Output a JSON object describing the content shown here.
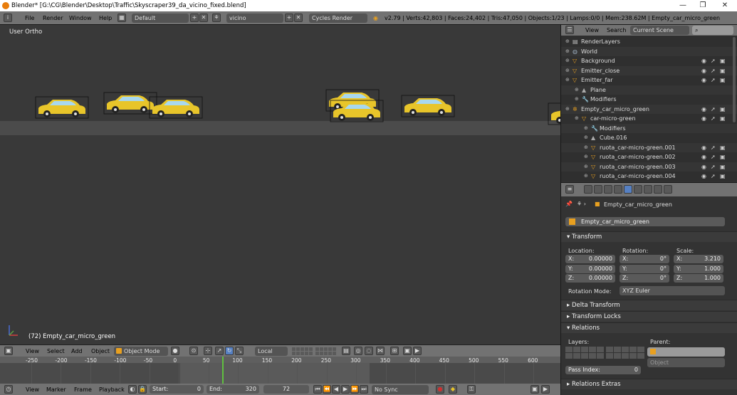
{
  "window": {
    "title": "Blender* [G:\\CG\\Blender\\Desktop\\Traffic\\Skyscraper39_da_vicino_fixed.blend]",
    "controls": [
      "—",
      "❐",
      "✕"
    ]
  },
  "infobar": {
    "menus": [
      "File",
      "Render",
      "Window",
      "Help"
    ],
    "screen_layout": "Default",
    "scene": "vicino",
    "render_engine": "Cycles Render",
    "stats": "v2.79 | Verts:42,803 | Faces:24,402 | Tris:47,050 | Objects:1/23 | Lamps:0/0 | Mem:238.62M | Empty_car_micro_green"
  },
  "viewport": {
    "view_label": "User Ortho",
    "object_label": "(72) Empty_car_micro_green",
    "header": {
      "menus": [
        "View",
        "Select",
        "Add",
        "Object"
      ],
      "mode": "Object Mode",
      "orientation": "Local"
    }
  },
  "timeline": {
    "ticks": [
      "-250",
      "-200",
      "-150",
      "-100",
      "-50",
      "0",
      "50",
      "100",
      "150",
      "200",
      "250",
      "300",
      "350",
      "400",
      "450",
      "500",
      "550",
      "600"
    ],
    "menus": [
      "View",
      "Marker",
      "Frame",
      "Playback"
    ],
    "start_label": "Start:",
    "start_value": "0",
    "end_label": "End:",
    "end_value": "320",
    "current_frame": "72",
    "sync": "No Sync"
  },
  "outliner": {
    "header": {
      "view": "View",
      "search": "Search",
      "display": "Current Scene"
    },
    "rows": [
      {
        "label": "RenderLayers",
        "indent": 0,
        "icon": "renderlayers-icon",
        "color": "#bbbbbb"
      },
      {
        "label": "World",
        "indent": 0,
        "icon": "world-icon",
        "color": "#9ab"
      },
      {
        "label": "Background",
        "indent": 0,
        "icon": "mesh-icon",
        "color": "#e8a020"
      },
      {
        "label": "Emitter_close",
        "indent": 0,
        "icon": "mesh-icon",
        "color": "#e8a020"
      },
      {
        "label": "Emitter_far",
        "indent": 0,
        "icon": "mesh-icon",
        "color": "#e8a020"
      },
      {
        "label": "Plane",
        "indent": 1,
        "icon": "mesh-data-icon",
        "color": "#aaa"
      },
      {
        "label": "Modifiers",
        "indent": 1,
        "icon": "wrench-icon",
        "color": "#aaa"
      },
      {
        "label": "Empty_car_micro_green",
        "indent": 0,
        "icon": "empty-icon",
        "color": "#e8a020"
      },
      {
        "label": "car-micro-green",
        "indent": 1,
        "icon": "mesh-icon",
        "color": "#e8a020"
      },
      {
        "label": "Modifiers",
        "indent": 2,
        "icon": "wrench-icon",
        "color": "#aaa"
      },
      {
        "label": "Cube.016",
        "indent": 2,
        "icon": "mesh-data-icon",
        "color": "#aaa"
      },
      {
        "label": "ruota_car-micro-green.001",
        "indent": 2,
        "icon": "mesh-icon",
        "color": "#e8a020"
      },
      {
        "label": "ruota_car-micro-green.002",
        "indent": 2,
        "icon": "mesh-icon",
        "color": "#e8a020"
      },
      {
        "label": "ruota_car-micro-green.003",
        "indent": 2,
        "icon": "mesh-icon",
        "color": "#e8a020"
      },
      {
        "label": "ruota_car-micro-green.004",
        "indent": 2,
        "icon": "mesh-icon",
        "color": "#e8a020"
      }
    ]
  },
  "properties": {
    "breadcrumb": "Empty_car_micro_green",
    "object_name": "Empty_car_micro_green",
    "transform": {
      "title": "Transform",
      "location_label": "Location:",
      "rotation_label": "Rotation:",
      "scale_label": "Scale:",
      "location": [
        {
          "k": "X:",
          "v": "0.00000"
        },
        {
          "k": "Y:",
          "v": "0.00000"
        },
        {
          "k": "Z:",
          "v": "0.00000"
        }
      ],
      "rotation": [
        {
          "k": "X:",
          "v": "0°"
        },
        {
          "k": "Y:",
          "v": "0°"
        },
        {
          "k": "Z:",
          "v": "0°"
        }
      ],
      "scale": [
        {
          "k": "X:",
          "v": "3.210"
        },
        {
          "k": "Y:",
          "v": "1.000"
        },
        {
          "k": "Z:",
          "v": "1.000"
        }
      ],
      "rotation_mode_label": "Rotation Mode:",
      "rotation_mode": "XYZ Euler"
    },
    "panels": {
      "delta": "Delta Transform",
      "locks": "Transform Locks",
      "relations": "Relations",
      "relations_extras": "Relations Extras"
    },
    "relations": {
      "layers_label": "Layers:",
      "parent_label": "Parent:",
      "parent_type": "Object",
      "pass_index_label": "Pass Index:",
      "pass_index": "0"
    }
  },
  "colors": {
    "accent": "#e8a020",
    "car": "#e8c52a",
    "timeline_cursor": "#60c040",
    "selection": "#5680c2"
  }
}
